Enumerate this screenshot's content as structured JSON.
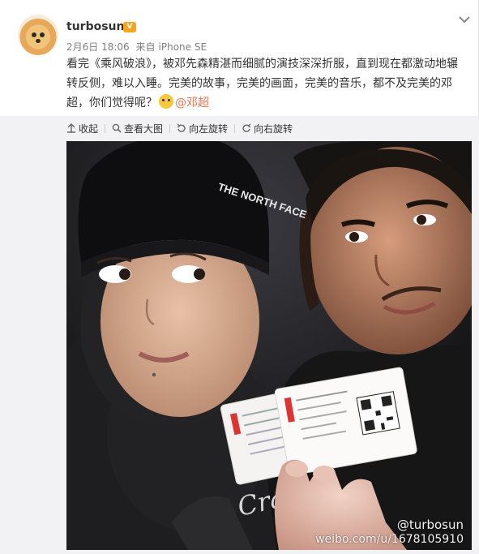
{
  "post": {
    "username": "turbosun",
    "badge": "V",
    "date": "2月6日 18:06",
    "source_prefix": "来自",
    "source": "iPhone SE",
    "text_main": "看完《乘风破浪》，被邓先森精湛而细腻的演技深深折服，直到现在都激动地辗转反侧，难以入睡。完美的故事，完美的画面，完美的音乐，都不及完美的邓超，你们觉得呢？",
    "mention": "@邓超"
  },
  "toolbar": {
    "collapse": "收起",
    "view_large": "查看大图",
    "rotate_left": "向左旋转",
    "rotate_right": "向右旋转"
  },
  "photo": {
    "watermark_handle": "@turbosun",
    "watermark_url": "weibo.com/u/1678105910",
    "cap_text": "THE NORTH FACE"
  },
  "colors": {
    "mention": "#eb7350",
    "meta": "#808080",
    "media_bg": "#f2f2f5"
  }
}
